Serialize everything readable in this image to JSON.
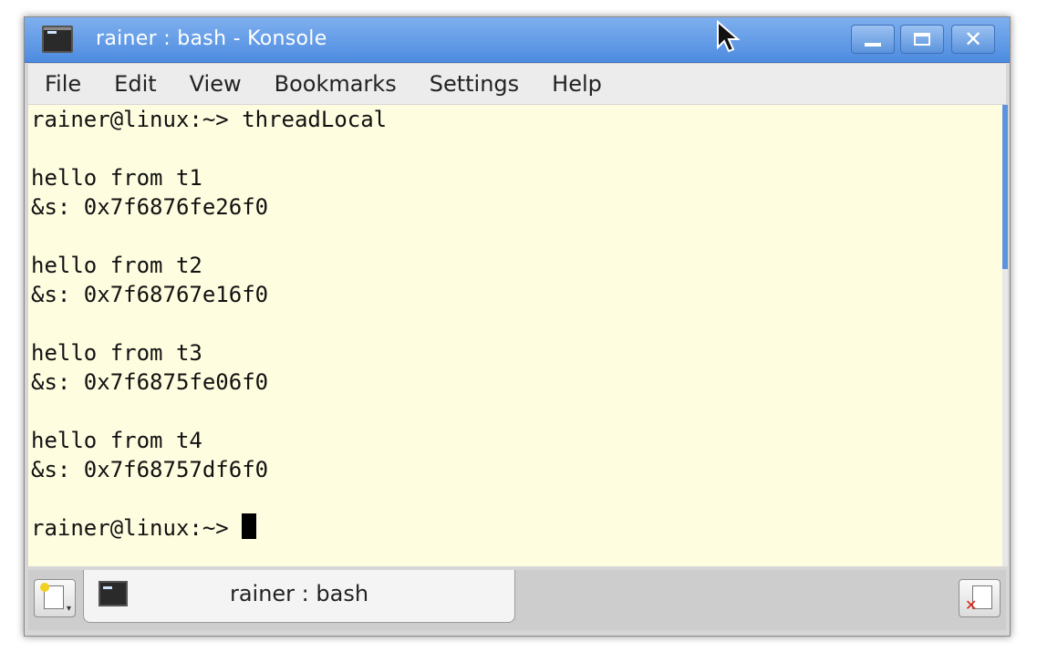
{
  "window": {
    "title": "rainer : bash - Konsole",
    "close_glyph": "✕",
    "icons": {
      "app": "terminal-icon",
      "minimize": "minimize-icon",
      "maximize": "maximize-icon",
      "close": "close-icon"
    }
  },
  "colors": {
    "titlebar": "#5b93dd",
    "terminal_background": "#fffde0",
    "terminal_text": "#111111",
    "menubar": "#ececec"
  },
  "menu": {
    "items": [
      "File",
      "Edit",
      "View",
      "Bookmarks",
      "Settings",
      "Help"
    ]
  },
  "terminal": {
    "lines": [
      "rainer@linux:~> threadLocal",
      "",
      "hello from t1",
      "&s: 0x7f6876fe26f0",
      "",
      "hello from t2",
      "&s: 0x7f68767e16f0",
      "",
      "hello from t3",
      "&s: 0x7f6875fe06f0",
      "",
      "hello from t4",
      "&s: 0x7f68757df6f0",
      ""
    ],
    "prompt": "rainer@linux:~> "
  },
  "tabs": {
    "new_tab_icon": "new-tab-icon",
    "close_tab_icon": "close-tab-icon",
    "items": [
      {
        "label": "rainer : bash",
        "icon": "terminal-icon",
        "active": true
      }
    ]
  }
}
